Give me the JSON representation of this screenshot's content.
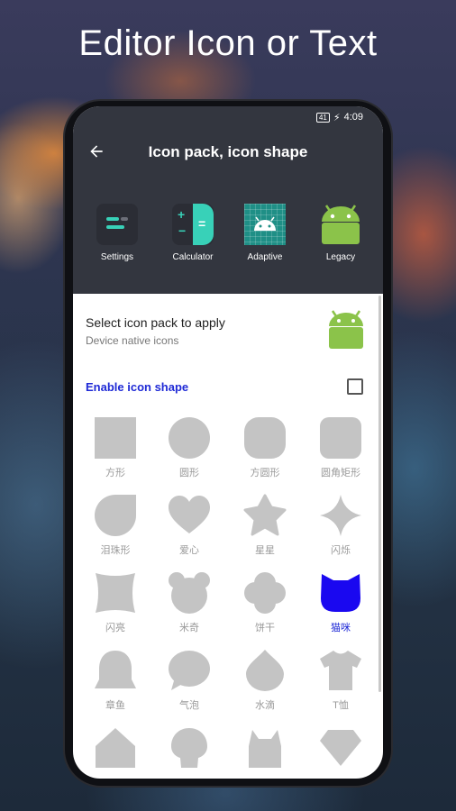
{
  "headline": "Editor Icon or Text",
  "statusbar": {
    "battery": "41",
    "time": "4:09"
  },
  "appbar": {
    "title": "Icon pack, icon shape",
    "back_icon": "arrow-back-icon"
  },
  "previews": [
    {
      "label": "Settings",
      "icon": "settings-app-icon"
    },
    {
      "label": "Calculator",
      "icon": "calculator-app-icon"
    },
    {
      "label": "Adaptive",
      "icon": "android-adaptive-icon"
    },
    {
      "label": "Legacy",
      "icon": "android-legacy-icon"
    }
  ],
  "icon_pack": {
    "title": "Select icon pack to apply",
    "subtitle": "Device native icons",
    "icon": "android-icon"
  },
  "enable_shape": {
    "label": "Enable icon shape",
    "checked": false
  },
  "shapes": [
    {
      "label": "方形",
      "selected": false
    },
    {
      "label": "圆形",
      "selected": false
    },
    {
      "label": "方圆形",
      "selected": false
    },
    {
      "label": "圆角矩形",
      "selected": false
    },
    {
      "label": "泪珠形",
      "selected": false
    },
    {
      "label": "爱心",
      "selected": false
    },
    {
      "label": "星星",
      "selected": false
    },
    {
      "label": "闪烁",
      "selected": false
    },
    {
      "label": "闪亮",
      "selected": false
    },
    {
      "label": "米奇",
      "selected": false
    },
    {
      "label": "饼干",
      "selected": false
    },
    {
      "label": "猫咪",
      "selected": true
    },
    {
      "label": "章鱼",
      "selected": false
    },
    {
      "label": "气泡",
      "selected": false
    },
    {
      "label": "水滴",
      "selected": false
    },
    {
      "label": "T恤",
      "selected": false
    }
  ],
  "colors": {
    "dark_header": "#33363f",
    "accent": "#1f2ad6",
    "shape_gray": "#c4c4c4",
    "android_green": "#8bc34a"
  }
}
